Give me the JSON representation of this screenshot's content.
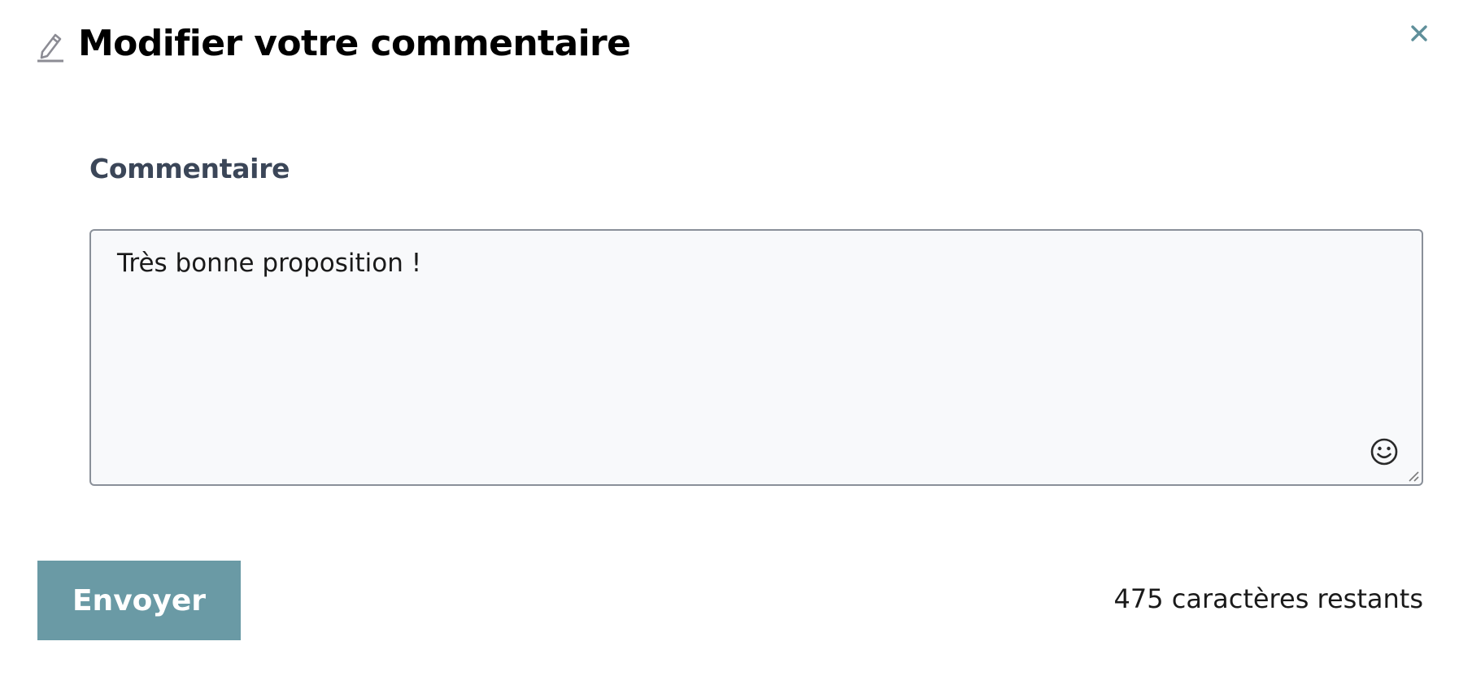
{
  "modal": {
    "title": "Modifier votre commentaire",
    "icons": {
      "title": "pencil-icon",
      "close": "close-icon",
      "emoji": "smiley-icon"
    }
  },
  "form": {
    "label": "Commentaire",
    "comment_value": "Très bonne proposition !",
    "send_label": "Envoyer",
    "remaining_text": "475 caractères restants"
  },
  "colors": {
    "accent": "#6a9aa5",
    "label": "#3b4658",
    "close": "#5f8f9a"
  }
}
